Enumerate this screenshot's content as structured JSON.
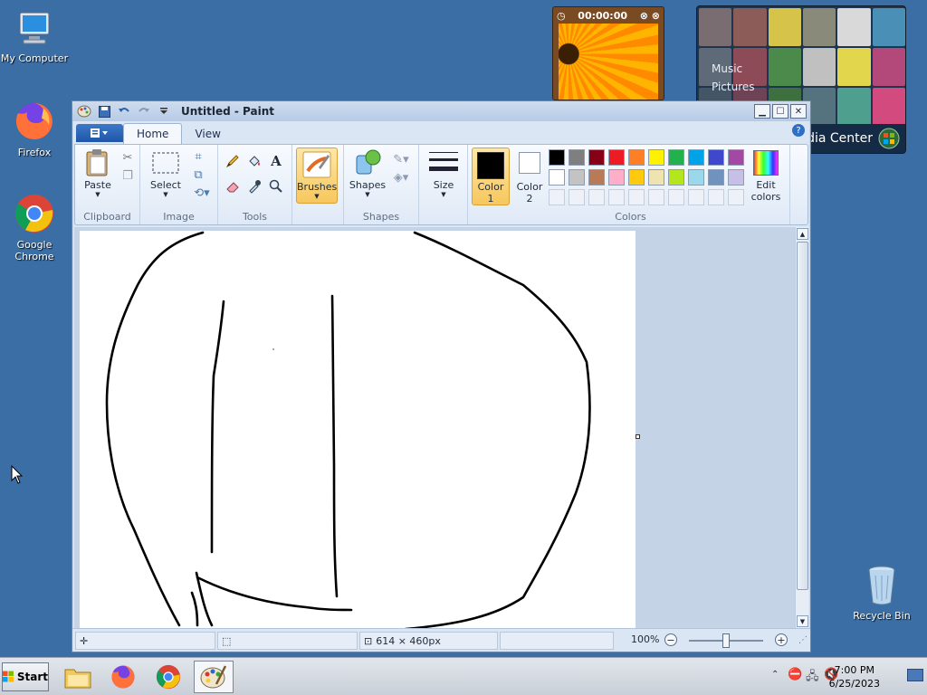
{
  "desktop": {
    "icons": {
      "my_computer": "My Computer",
      "firefox": "Firefox",
      "chrome": "Google Chrome",
      "recycle_bin": "Recycle Bin"
    }
  },
  "gadgets": {
    "clock_time": "00:00:00",
    "media_center": {
      "music": "Music",
      "pictures": "Pictures",
      "title_fragment": "dia Center"
    }
  },
  "window": {
    "title": "Untitled - Paint",
    "tabs": {
      "home": "Home",
      "view": "View"
    },
    "ribbon": {
      "clipboard": {
        "label": "Clipboard",
        "paste": "Paste"
      },
      "image": {
        "label": "Image",
        "select": "Select"
      },
      "tools": {
        "label": "Tools"
      },
      "brushes": "Brushes",
      "shapes": {
        "label": "Shapes",
        "button": "Shapes"
      },
      "size": "Size",
      "colors": {
        "label": "Colors",
        "color1": "Color",
        "color1_num": "1",
        "color2": "Color",
        "color2_num": "2",
        "edit": "Edit",
        "edit2": "colors",
        "active_color": "#000000",
        "row1": [
          "#000000",
          "#7f7f7f",
          "#880015",
          "#ed1c24",
          "#ff7f27",
          "#fff200",
          "#22b14c",
          "#00a2e8",
          "#3f48cc",
          "#a349a4"
        ],
        "row2": [
          "#ffffff",
          "#c3c3c3",
          "#b97a57",
          "#ffaec9",
          "#ffc90e",
          "#efe4b0",
          "#b5e61d",
          "#99d9ea",
          "#7092be",
          "#c8bfe7"
        ]
      }
    },
    "status": {
      "dimensions": "614 × 460px",
      "zoom": "100%"
    }
  },
  "taskbar": {
    "start": "Start",
    "time": "7:00 PM",
    "date": "6/25/2023"
  },
  "icons": {
    "app_menu": "app-menu-icon",
    "save": "save-icon",
    "undo": "undo-icon",
    "redo": "redo-icon",
    "paste": "paste-icon",
    "pencil": "pencil-icon",
    "fill": "fill-icon",
    "text": "text-icon",
    "eraser": "eraser-icon",
    "color_picker": "color-picker-icon",
    "magnifier": "magnifier-icon"
  }
}
